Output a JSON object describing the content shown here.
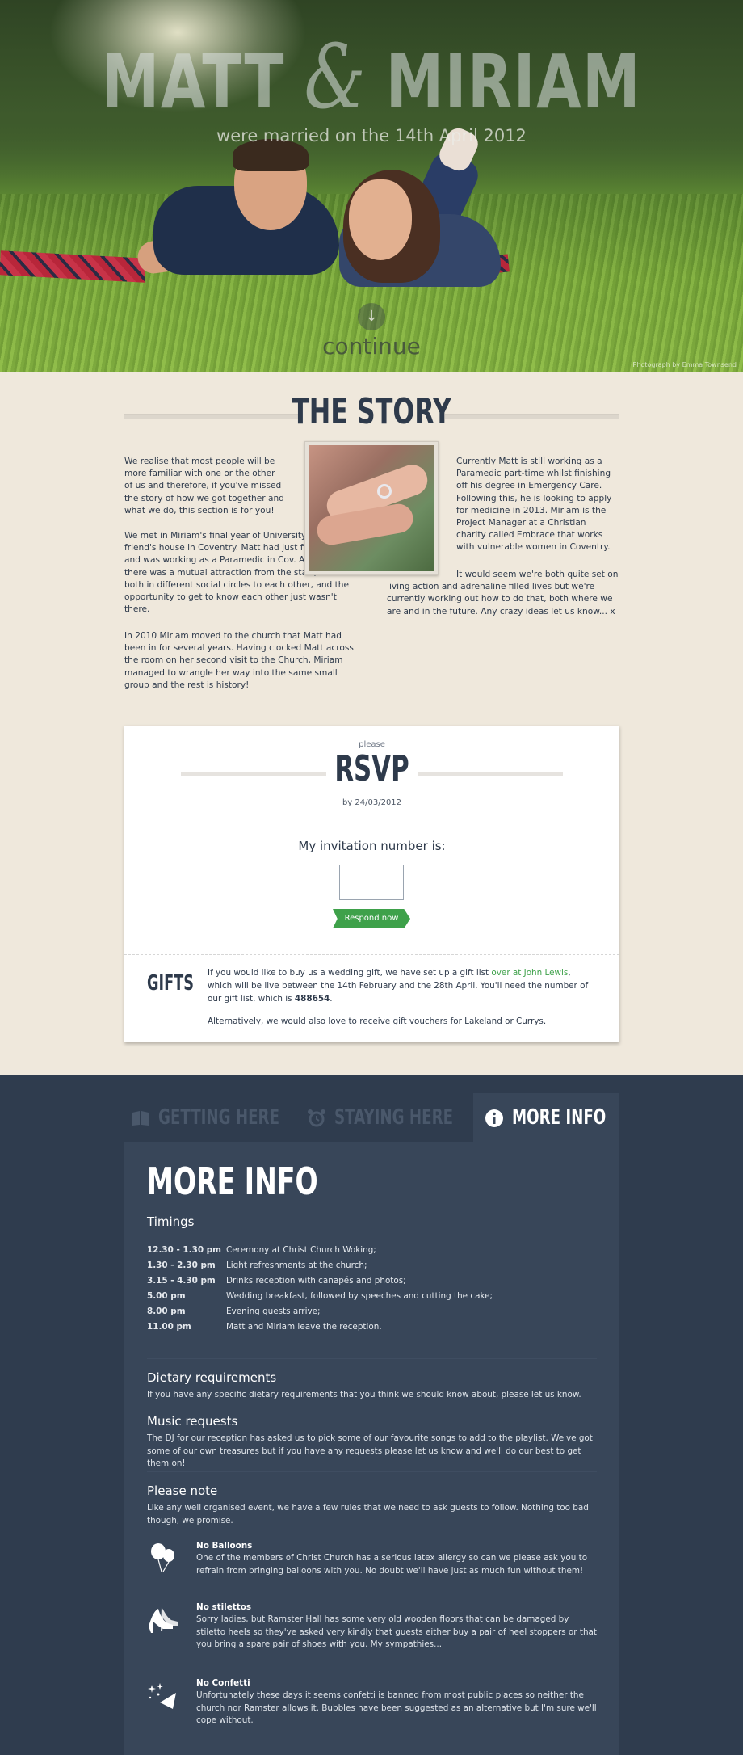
{
  "hero": {
    "name1": "MATT",
    "ampersand": "&",
    "name2": "MIRIAM",
    "subtitle": "were married on the 14th April 2012",
    "continue_label": "continue",
    "photo_credit": "Photograph by Emma Townsend"
  },
  "story": {
    "heading": "THE STORY",
    "left_paragraphs": [
      "We realise that most people will be more familiar with one or the other of us and therefore, if you've missed the story of how we got together and what we do, this section is for you!",
      "We met in Miriam's final year of University at a mutual friend's house in Coventry. Matt had just finished Uni and was working as a Paramedic in Cov. Although there was a mutual attraction from the start, we were both in different social circles to each other, and the opportunity to get to know each other just wasn't there.",
      "In 2010 Miriam moved to the church that Matt had been in for several years. Having clocked Matt across the room on her second visit to the Church, Miriam managed to wrangle her way into the same small group and the rest is history!"
    ],
    "right_paragraphs": [
      "Currently Matt is still working as a Paramedic part-time whilst finishing off his degree in Emergency Care. Following this, he is looking to apply for medicine in 2013. Miriam is the Project Manager at a Christian charity called Embrace that works with vulnerable women in Coventry.",
      "It would seem we're both quite set on living action and adrenaline filled lives but we're currently working out how to do that, both where we are and in the future. Any crazy ideas let us know... x"
    ]
  },
  "rsvp": {
    "please": "please",
    "title": "RSVP",
    "by": "by 24/03/2012",
    "invitation_label": "My invitation number is:",
    "invitation_value": "",
    "respond_label": "Respond now"
  },
  "gifts": {
    "heading": "GIFTS",
    "text_before": "If you would like to buy us a wedding gift, we have set up a gift list ",
    "link_text": "over at John Lewis",
    "text_after": ", which will be live between the 14th February and the 28th April. You'll need the number of our gift list, which is ",
    "gift_number": "488654",
    "alt_text": "Alternatively, we would also love to receive gift vouchers for Lakeland or Currys."
  },
  "tabs": [
    {
      "label": "GETTING HERE",
      "icon": "book-icon",
      "active": false
    },
    {
      "label": "STAYING HERE",
      "icon": "alarm-clock-icon",
      "active": false
    },
    {
      "label": "MORE INFO",
      "icon": "info-icon",
      "active": true
    }
  ],
  "more_info": {
    "heading": "MORE INFO",
    "timings_heading": "Timings",
    "timings": [
      {
        "time": "12.30 - 1.30 pm",
        "event": "Ceremony at Christ Church Woking;"
      },
      {
        "time": "1.30 - 2.30 pm",
        "event": "Light refreshments at the church;"
      },
      {
        "time": "3.15 - 4.30 pm",
        "event": "Drinks reception with canapés and photos;"
      },
      {
        "time": "5.00 pm",
        "event": "Wedding breakfast, followed by speeches and cutting the cake;"
      },
      {
        "time": "8.00 pm",
        "event": "Evening guests arrive;"
      },
      {
        "time": "11.00 pm",
        "event": "Matt and Miriam leave the reception."
      }
    ],
    "dietary_heading": "Dietary requirements",
    "dietary_text": "If you have any specific dietary requirements that you think we should know about, please let us know.",
    "music_heading": "Music requests",
    "music_text": "The DJ for our reception has asked us to pick some of our favourite songs to add to the playlist. We've got some of our own treasures but if you have any requests please let us know and we'll do our best to get them on!",
    "note_heading": "Please note",
    "note_text": "Like any well organised event, we have a few rules that we need to ask guests to follow. Nothing too bad though, we promise.",
    "rules": [
      {
        "icon": "balloons-icon",
        "title": "No Balloons",
        "text": "One of the members of Christ Church has a serious latex allergy so can we please ask you to refrain from bringing balloons with you. No doubt we'll have just as much fun without them!"
      },
      {
        "icon": "stiletto-icon",
        "title": "No stilettos",
        "text": "Sorry ladies, but Ramster Hall has some very old wooden floors that can be damaged by stiletto heels so they've asked very kindly that guests either buy a pair of heel stoppers or that you bring a spare pair of shoes with you. My sympathies..."
      },
      {
        "icon": "confetti-icon",
        "title": "No Confetti",
        "text": "Unfortunately these days it seems confetti is banned from most public places so neither the church nor Ramster allows it. Bubbles have been suggested as an alternative but I'm sure we'll cope without."
      }
    ]
  },
  "colors": {
    "navy": "#2e3a4b",
    "accent_green": "#3ea14a",
    "cream": "#efe8dc",
    "dark_bg": "#2f3c4e",
    "panel_bg": "#384659"
  }
}
